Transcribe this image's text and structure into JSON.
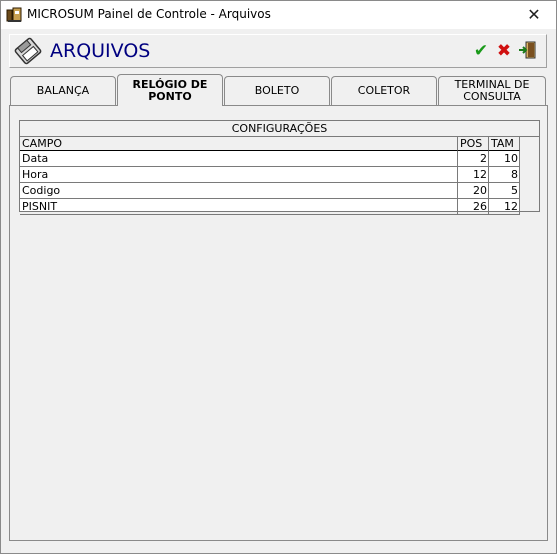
{
  "window": {
    "title": "MICROSUM Painel de Controle - Arquivos",
    "close_label": "✕"
  },
  "header": {
    "title": "ARQUIVOS",
    "ok_symbol": "✔",
    "cancel_symbol": "✖"
  },
  "tabs": [
    {
      "label": "BALANÇA"
    },
    {
      "label": "RELÓGIO DE PONTO"
    },
    {
      "label": "BOLETO"
    },
    {
      "label": "COLETOR"
    },
    {
      "label": "TERMINAL DE CONSULTA"
    }
  ],
  "active_tab": "RELÓGIO DE PONTO",
  "grid": {
    "caption": "CONFIGURAÇÕES",
    "columns": [
      "CAMPO",
      "POS",
      "TAM"
    ],
    "rows": [
      {
        "campo": "Data",
        "pos": "2",
        "tam": "10"
      },
      {
        "campo": "Hora",
        "pos": "12",
        "tam": "8"
      },
      {
        "campo": "Codigo",
        "pos": "20",
        "tam": "5"
      },
      {
        "campo": "PISNIT",
        "pos": "26",
        "tam": "12"
      }
    ]
  },
  "colors": {
    "header_title": "#000080",
    "ok_green": "#1a9a1a",
    "cancel_red": "#d01010"
  }
}
